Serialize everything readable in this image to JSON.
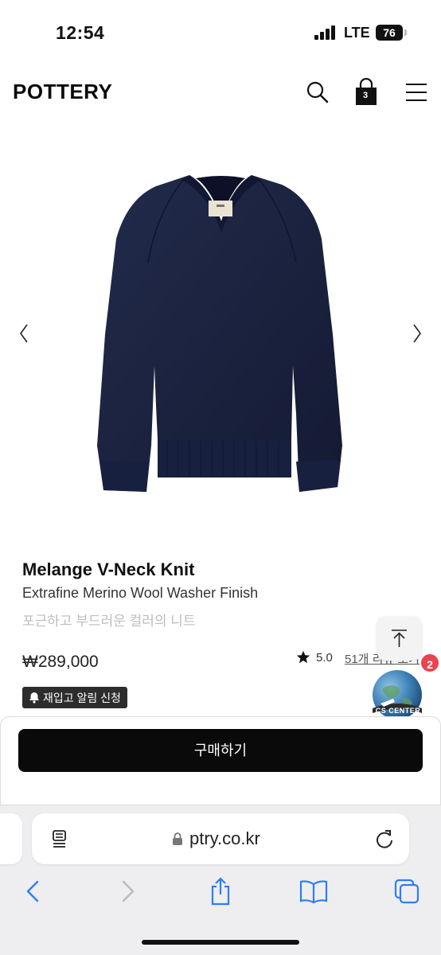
{
  "status_bar": {
    "time": "12:54",
    "network": "LTE",
    "battery": "76"
  },
  "header": {
    "logo": "POTTERY",
    "cart_count": "3",
    "icons": [
      "search-icon",
      "shopping-bag-icon",
      "menu-icon"
    ]
  },
  "product": {
    "image_description_icon": "sweater-image",
    "name": "Melange V-Neck Knit",
    "subtitle": "Extrafine Merino Wool Washer Finish",
    "description": "포근하고 부드러운 컬러의 니트",
    "price": "₩289,000",
    "rating": "5.0",
    "review_link": "51개 리뷰 보기",
    "restock_label": "재입고 알림 신청"
  },
  "floating": {
    "notification_count": "2",
    "cs_label": "CS CENTER"
  },
  "purchase": {
    "buy_label": "구매하기"
  },
  "browser": {
    "url": "ptry.co.kr",
    "toolbar_icons": [
      "back-icon",
      "forward-icon",
      "share-icon",
      "bookmarks-icon",
      "tabs-icon"
    ]
  },
  "colors": {
    "sweater": "#1b2340",
    "buy_button": "#0a0a0a",
    "badge": "#e94450",
    "safari_bar": "#eeeef0"
  }
}
